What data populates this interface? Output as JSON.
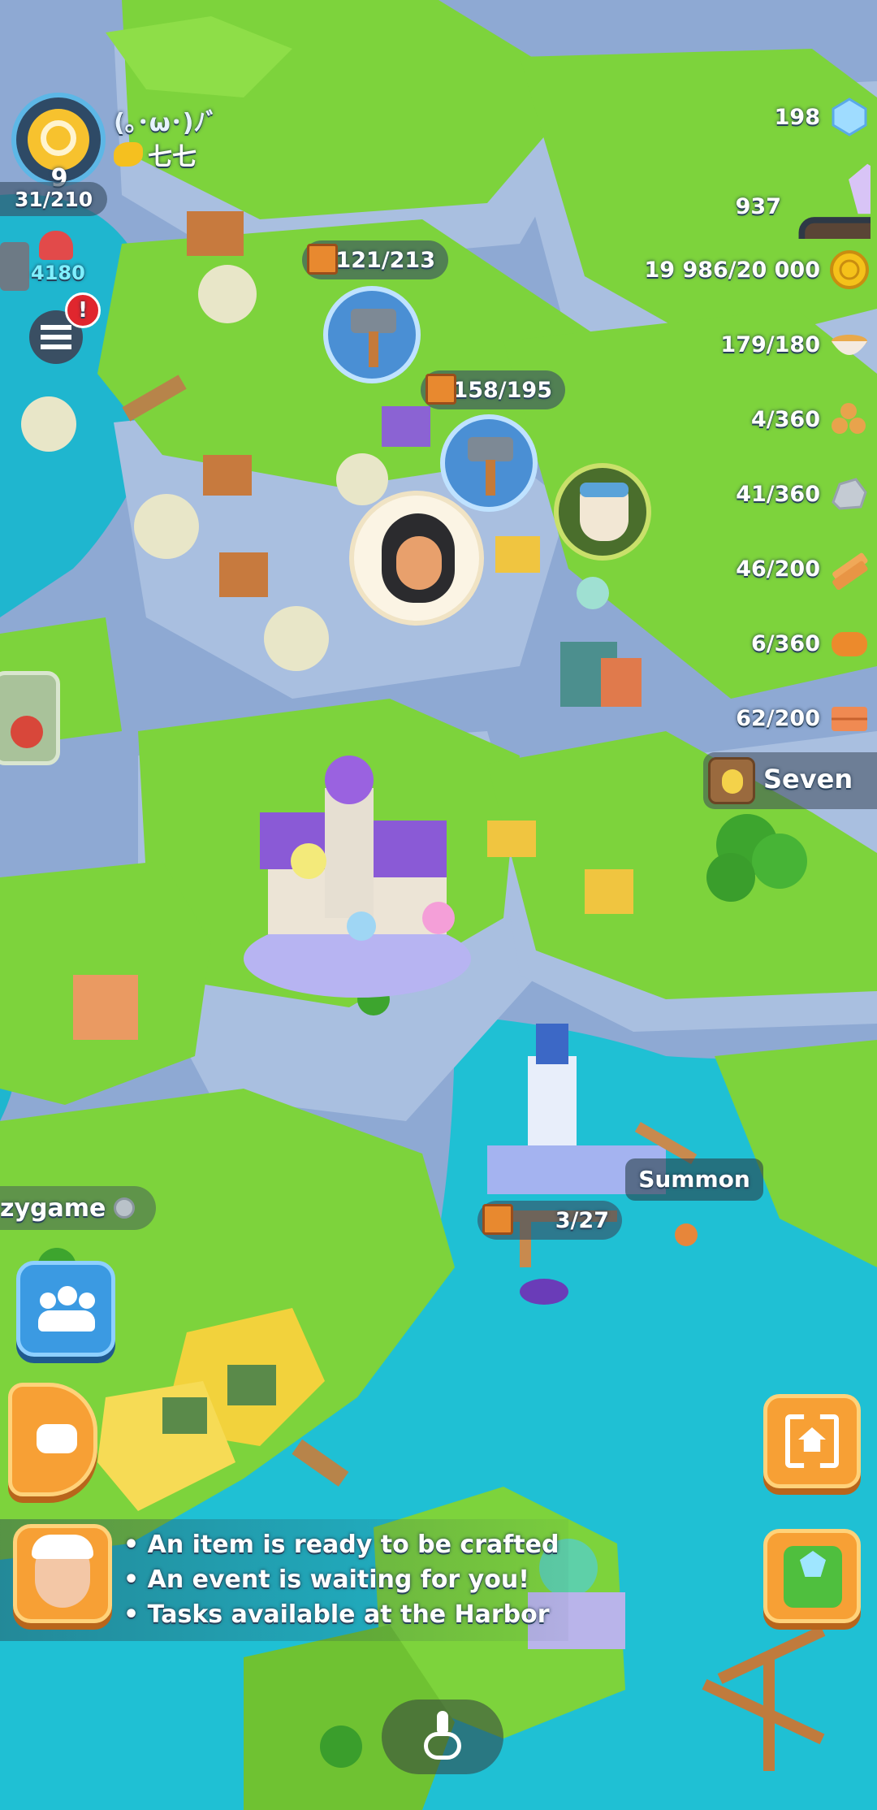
{
  "player": {
    "level": "9",
    "xp": "31/210",
    "name": "(｡･ω･)ﾉﾞ",
    "guild": "七七",
    "energy": "4180"
  },
  "resources": [
    {
      "value": "198",
      "icon": "diamond-icon"
    },
    {
      "value": "937",
      "icon": "crystal-minecart-icon"
    },
    {
      "value": "19 986/20 000",
      "icon": "gold-coin-icon"
    },
    {
      "value": "179/180",
      "icon": "soup-bowl-icon"
    },
    {
      "value": "4/360",
      "icon": "log-pile-icon"
    },
    {
      "value": "41/360",
      "icon": "stone-icon"
    },
    {
      "value": "46/200",
      "icon": "plank-icon"
    },
    {
      "value": "6/360",
      "icon": "clay-icon"
    },
    {
      "value": "62/200",
      "icon": "brick-icon"
    }
  ],
  "map": {
    "crate_counters": [
      "121/213",
      "158/195",
      "3/27"
    ],
    "neighbor_seven": "Seven",
    "neighbor_left": "zygame",
    "summon_label": "Summon"
  },
  "notifications": {
    "menu_badge": "!",
    "tips": [
      "An item is ready to be crafted",
      "An event is waiting for you!",
      "Tasks available at the Harbor"
    ]
  },
  "colors": {
    "water": "#1fc0d4",
    "grass": "#7dd33c",
    "cliff": "#9fb9dc",
    "orange_button": "#f7a035",
    "blue_button": "#3b9ae2"
  }
}
